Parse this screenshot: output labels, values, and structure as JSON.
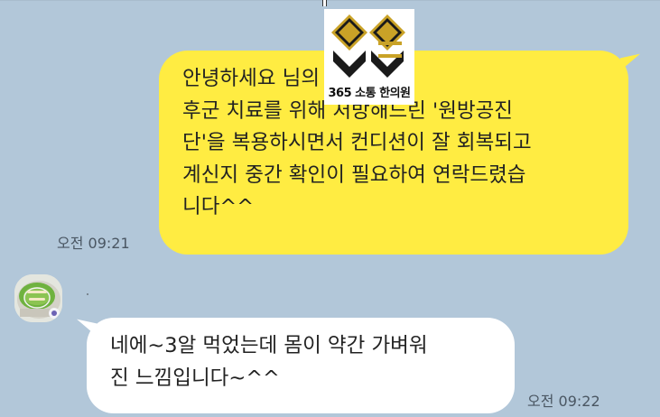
{
  "chat": {
    "outgoing": {
      "text": "안녕하세요                         님의 피로증\n후군 치료를 위해 처방해드린 '원방공진\n단'을 복용하시면서 컨디션이 잘 회복되고\n계신지 중간 확인이 필요하여 연락드렸습\n니다^^",
      "time": "오전 09:21"
    },
    "logo": {
      "text": "365 소통 한의원",
      "colors": {
        "gold": "#c9a227",
        "dark": "#1a1a1a"
      }
    },
    "incoming": {
      "text": "네에~3알 먹었는데 몸이 약간 가벼워\n진 느낌입니다~^^",
      "time": "오전 09:22"
    }
  },
  "colors": {
    "background": "#b2c7d9",
    "outgoing_bubble": "#ffec42",
    "incoming_bubble": "#ffffff"
  }
}
